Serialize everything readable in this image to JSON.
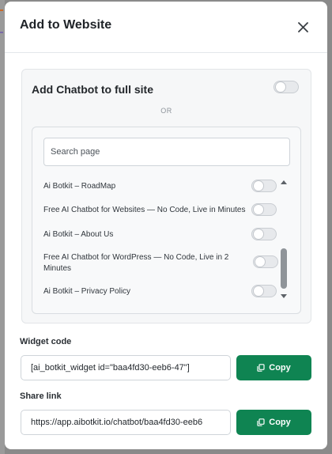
{
  "modal": {
    "title": "Add to Website"
  },
  "full_site": {
    "label": "Add Chatbot to full site",
    "enabled": false
  },
  "divider": {
    "text": "OR"
  },
  "search": {
    "placeholder": "Search page",
    "value": ""
  },
  "pages": [
    {
      "title": "Ai Botkit – RoadMap",
      "enabled": false
    },
    {
      "title": "Free AI Chatbot for Websites — No Code, Live in Minutes",
      "enabled": false
    },
    {
      "title": "Ai Botkit – About Us",
      "enabled": false
    },
    {
      "title": "Free AI Chatbot for WordPress — No Code, Live in 2 Minutes",
      "enabled": false
    },
    {
      "title": "Ai Botkit – Privacy Policy",
      "enabled": false
    }
  ],
  "widget": {
    "label": "Widget code",
    "value": "[ai_botkit_widget id=\"baa4fd30-eeb6-47\"]",
    "copy_label": "Copy"
  },
  "share": {
    "label": "Share link",
    "value": "https://app.aibotkit.io/chatbot/baa4fd30-eeb6",
    "copy_label": "Copy"
  },
  "colors": {
    "accent": "#0f8452",
    "overlay": "#8a8a8a"
  },
  "icons": {
    "close": "close-icon",
    "copy": "copy-icon",
    "scroll_up": "scroll-up-arrow",
    "scroll_down": "scroll-down-arrow"
  }
}
